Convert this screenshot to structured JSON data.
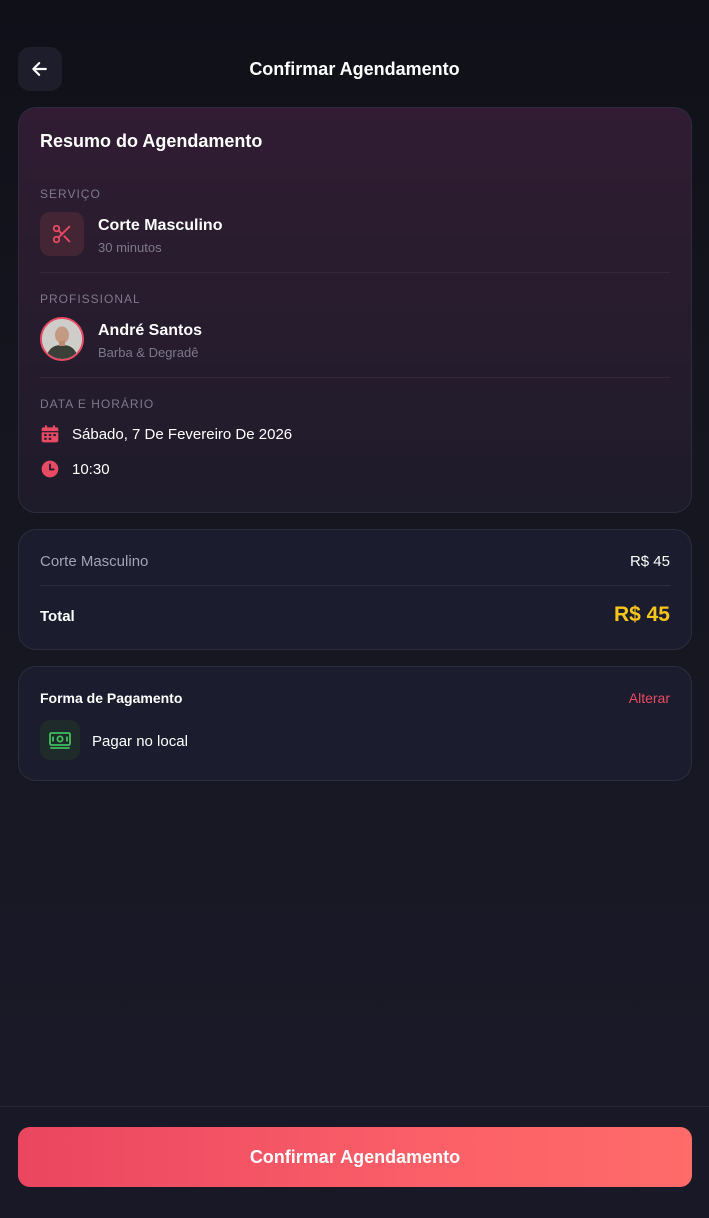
{
  "header": {
    "title": "Confirmar Agendamento",
    "back_icon": "arrow-left-icon"
  },
  "summary": {
    "title": "Resumo do Agendamento",
    "service": {
      "section_label": "SERVIÇO",
      "name": "Corte Masculino",
      "duration": "30 minutos",
      "icon": "scissors-icon"
    },
    "professional": {
      "section_label": "PROFISSIONAL",
      "name": "André Santos",
      "specialty": "Barba & Degradê"
    },
    "datetime": {
      "section_label": "DATA E HORÁRIO",
      "date": "Sábado, 7 De Fevereiro De 2026",
      "time": "10:30",
      "date_icon": "calendar-icon",
      "time_icon": "clock-icon"
    }
  },
  "pricing": {
    "item_label": "Corte Masculino",
    "item_price": "R$ 45",
    "total_label": "Total",
    "total_value": "R$ 45"
  },
  "payment": {
    "title": "Forma de Pagamento",
    "change_label": "Alterar",
    "method": "Pagar no local",
    "method_icon": "cash-icon"
  },
  "footer": {
    "confirm_label": "Confirmar Agendamento"
  },
  "colors": {
    "accent": "#e84a64",
    "total_price": "#f8c51c",
    "background": "#1a1a29",
    "card": "#1b1c2d",
    "button_gradient_start": "#ea4660",
    "button_gradient_end": "#ff6b69"
  }
}
